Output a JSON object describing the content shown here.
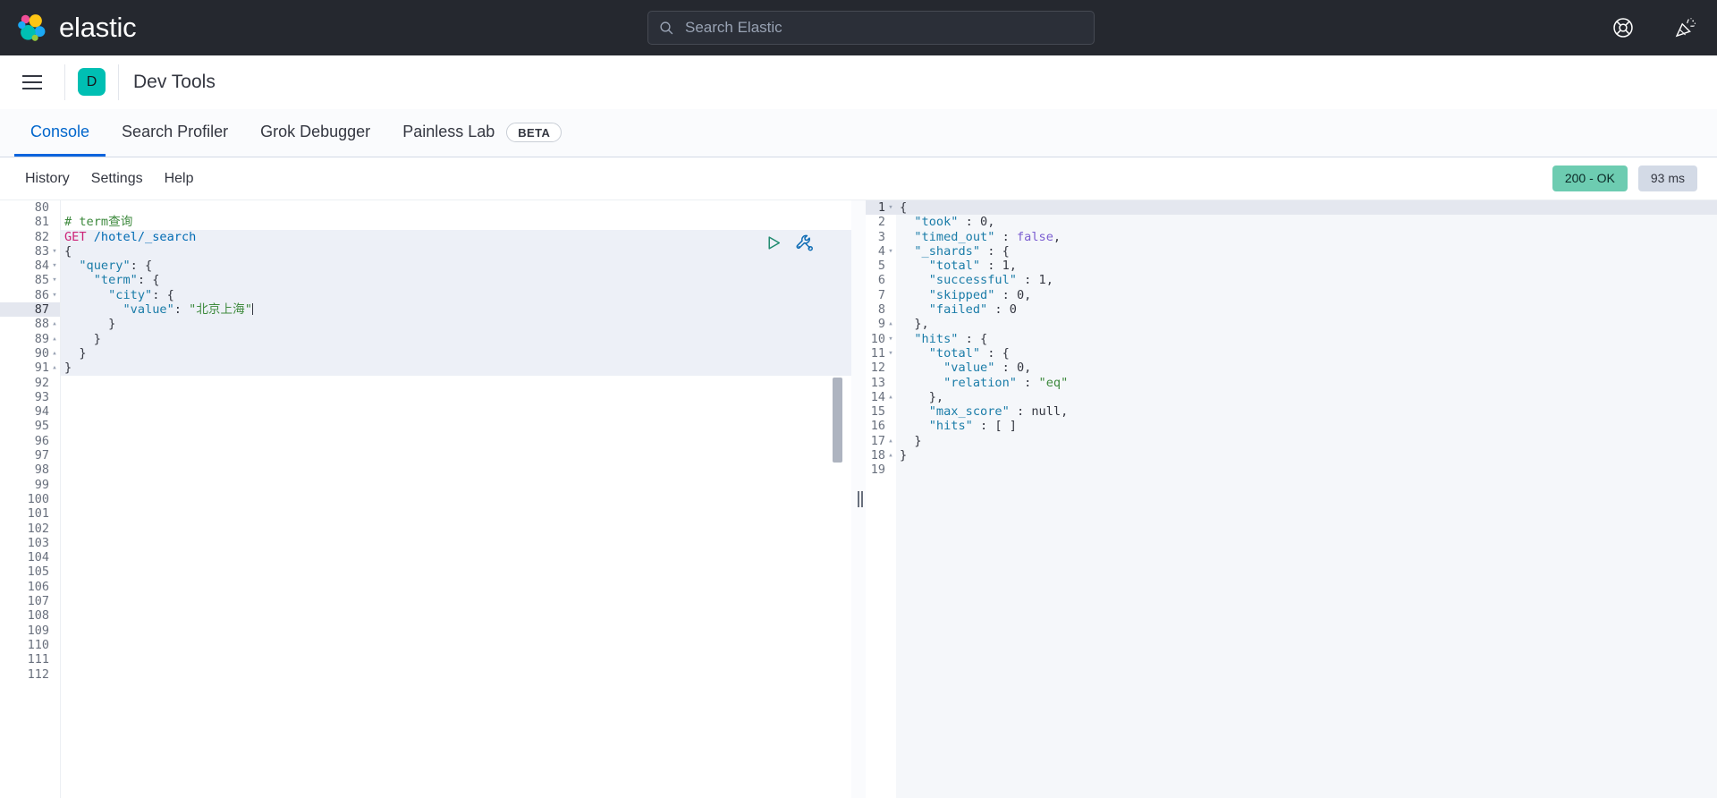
{
  "topbar": {
    "brand_name": "elastic",
    "logo_colors": {
      "pink": "#f04e98",
      "yellow": "#fec514",
      "blue": "#1ba9f5",
      "teal": "#00bfb3",
      "green": "#7de2d1",
      "lightgreen": "#93c83e"
    },
    "search": {
      "placeholder": "Search Elastic",
      "value": "",
      "icon": "search-icon"
    },
    "icons": [
      {
        "name": "help-lifebuoy-icon",
        "label": "Help"
      },
      {
        "name": "whats-new-party-popper-icon",
        "label": "What's new"
      }
    ]
  },
  "appheader": {
    "menu_icon": "hamburger-menu-icon",
    "app_badge_letter": "D",
    "app_badge_color": "#00bfb3",
    "title": "Dev Tools"
  },
  "tabs": [
    {
      "label": "Console",
      "active": true,
      "badge": null
    },
    {
      "label": "Search Profiler",
      "active": false,
      "badge": null
    },
    {
      "label": "Grok Debugger",
      "active": false,
      "badge": null
    },
    {
      "label": "Painless Lab",
      "active": false,
      "badge": "BETA"
    }
  ],
  "console_toolbar": {
    "buttons": [
      "History",
      "Settings",
      "Help"
    ],
    "status_code": "200 - OK",
    "status_color": "#6dccb1",
    "duration": "93 ms",
    "duration_color": "#d3dae6"
  },
  "request_editor": {
    "first_line_number": 80,
    "last_line_number": 112,
    "current_line": 87,
    "actions": [
      {
        "name": "send-request-play-icon",
        "color": "#1d8a6e"
      },
      {
        "name": "request-options-wrench-icon",
        "color": "#0d6bb4"
      }
    ],
    "lines": [
      {
        "n": 80,
        "fold": "",
        "segs": [],
        "in_block": false
      },
      {
        "n": 81,
        "fold": "",
        "segs": [
          {
            "t": "# term查询",
            "c": "tok-comment"
          }
        ],
        "in_block": false
      },
      {
        "n": 82,
        "fold": "",
        "segs": [
          {
            "t": "GET",
            "c": "tok-method"
          },
          {
            "t": " /hotel/_search",
            "c": "tok-url"
          }
        ],
        "in_block": true
      },
      {
        "n": 83,
        "fold": "▾",
        "segs": [
          {
            "t": "{",
            "c": "tok-punc"
          }
        ],
        "in_block": true
      },
      {
        "n": 84,
        "fold": "▾",
        "segs": [
          {
            "t": "  ",
            "c": "tok-punc"
          },
          {
            "t": "\"query\"",
            "c": "tok-key"
          },
          {
            "t": ": {",
            "c": "tok-punc"
          }
        ],
        "in_block": true
      },
      {
        "n": 85,
        "fold": "▾",
        "segs": [
          {
            "t": "    ",
            "c": "tok-punc"
          },
          {
            "t": "\"term\"",
            "c": "tok-key"
          },
          {
            "t": ": {",
            "c": "tok-punc"
          }
        ],
        "in_block": true
      },
      {
        "n": 86,
        "fold": "▾",
        "segs": [
          {
            "t": "      ",
            "c": "tok-punc"
          },
          {
            "t": "\"city\"",
            "c": "tok-key"
          },
          {
            "t": ": {",
            "c": "tok-punc"
          }
        ],
        "in_block": true
      },
      {
        "n": 87,
        "fold": "",
        "segs": [
          {
            "t": "        ",
            "c": "tok-punc"
          },
          {
            "t": "\"value\"",
            "c": "tok-key"
          },
          {
            "t": ": ",
            "c": "tok-punc"
          },
          {
            "t": "\"北京上海\"",
            "c": "tok-str"
          }
        ],
        "in_block": true,
        "caret": true
      },
      {
        "n": 88,
        "fold": "▴",
        "segs": [
          {
            "t": "      }",
            "c": "tok-punc"
          }
        ],
        "in_block": true
      },
      {
        "n": 89,
        "fold": "▴",
        "segs": [
          {
            "t": "    }",
            "c": "tok-punc"
          }
        ],
        "in_block": true
      },
      {
        "n": 90,
        "fold": "▴",
        "segs": [
          {
            "t": "  }",
            "c": "tok-punc"
          }
        ],
        "in_block": true
      },
      {
        "n": 91,
        "fold": "▴",
        "segs": [
          {
            "t": "}",
            "c": "tok-punc"
          }
        ],
        "in_block": true
      },
      {
        "n": 92,
        "fold": "",
        "segs": [],
        "in_block": false
      },
      {
        "n": 93,
        "fold": "",
        "segs": [],
        "in_block": false
      },
      {
        "n": 94,
        "fold": "",
        "segs": [],
        "in_block": false
      },
      {
        "n": 95,
        "fold": "",
        "segs": [],
        "in_block": false
      },
      {
        "n": 96,
        "fold": "",
        "segs": [],
        "in_block": false
      },
      {
        "n": 97,
        "fold": "",
        "segs": [],
        "in_block": false
      },
      {
        "n": 98,
        "fold": "",
        "segs": [],
        "in_block": false
      },
      {
        "n": 99,
        "fold": "",
        "segs": [],
        "in_block": false
      },
      {
        "n": 100,
        "fold": "",
        "segs": [],
        "in_block": false
      },
      {
        "n": 101,
        "fold": "",
        "segs": [],
        "in_block": false
      },
      {
        "n": 102,
        "fold": "",
        "segs": [],
        "in_block": false
      },
      {
        "n": 103,
        "fold": "",
        "segs": [],
        "in_block": false
      },
      {
        "n": 104,
        "fold": "",
        "segs": [],
        "in_block": false
      },
      {
        "n": 105,
        "fold": "",
        "segs": [],
        "in_block": false
      },
      {
        "n": 106,
        "fold": "",
        "segs": [],
        "in_block": false
      },
      {
        "n": 107,
        "fold": "",
        "segs": [],
        "in_block": false
      },
      {
        "n": 108,
        "fold": "",
        "segs": [],
        "in_block": false
      },
      {
        "n": 109,
        "fold": "",
        "segs": [],
        "in_block": false
      },
      {
        "n": 110,
        "fold": "",
        "segs": [],
        "in_block": false
      },
      {
        "n": 111,
        "fold": "",
        "segs": [],
        "in_block": false
      },
      {
        "n": 112,
        "fold": "",
        "segs": [],
        "in_block": false
      }
    ]
  },
  "response_editor": {
    "lines": [
      {
        "n": 1,
        "fold": "▾",
        "segs": [
          {
            "t": "{",
            "c": "tok-punc"
          }
        ],
        "cur": true
      },
      {
        "n": 2,
        "fold": "",
        "segs": [
          {
            "t": "  ",
            "c": "tok-punc"
          },
          {
            "t": "\"took\"",
            "c": "tok-key"
          },
          {
            "t": " : ",
            "c": "tok-punc"
          },
          {
            "t": "0",
            "c": "tok-num"
          },
          {
            "t": ",",
            "c": "tok-punc"
          }
        ]
      },
      {
        "n": 3,
        "fold": "",
        "segs": [
          {
            "t": "  ",
            "c": "tok-punc"
          },
          {
            "t": "\"timed_out\"",
            "c": "tok-key"
          },
          {
            "t": " : ",
            "c": "tok-punc"
          },
          {
            "t": "false",
            "c": "tok-bool"
          },
          {
            "t": ",",
            "c": "tok-punc"
          }
        ]
      },
      {
        "n": 4,
        "fold": "▾",
        "segs": [
          {
            "t": "  ",
            "c": "tok-punc"
          },
          {
            "t": "\"_shards\"",
            "c": "tok-key"
          },
          {
            "t": " : {",
            "c": "tok-punc"
          }
        ]
      },
      {
        "n": 5,
        "fold": "",
        "segs": [
          {
            "t": "    ",
            "c": "tok-punc"
          },
          {
            "t": "\"total\"",
            "c": "tok-key"
          },
          {
            "t": " : ",
            "c": "tok-punc"
          },
          {
            "t": "1",
            "c": "tok-num"
          },
          {
            "t": ",",
            "c": "tok-punc"
          }
        ]
      },
      {
        "n": 6,
        "fold": "",
        "segs": [
          {
            "t": "    ",
            "c": "tok-punc"
          },
          {
            "t": "\"successful\"",
            "c": "tok-key"
          },
          {
            "t": " : ",
            "c": "tok-punc"
          },
          {
            "t": "1",
            "c": "tok-num"
          },
          {
            "t": ",",
            "c": "tok-punc"
          }
        ]
      },
      {
        "n": 7,
        "fold": "",
        "segs": [
          {
            "t": "    ",
            "c": "tok-punc"
          },
          {
            "t": "\"skipped\"",
            "c": "tok-key"
          },
          {
            "t": " : ",
            "c": "tok-punc"
          },
          {
            "t": "0",
            "c": "tok-num"
          },
          {
            "t": ",",
            "c": "tok-punc"
          }
        ]
      },
      {
        "n": 8,
        "fold": "",
        "segs": [
          {
            "t": "    ",
            "c": "tok-punc"
          },
          {
            "t": "\"failed\"",
            "c": "tok-key"
          },
          {
            "t": " : ",
            "c": "tok-punc"
          },
          {
            "t": "0",
            "c": "tok-num"
          }
        ]
      },
      {
        "n": 9,
        "fold": "▴",
        "segs": [
          {
            "t": "  },",
            "c": "tok-punc"
          }
        ]
      },
      {
        "n": 10,
        "fold": "▾",
        "segs": [
          {
            "t": "  ",
            "c": "tok-punc"
          },
          {
            "t": "\"hits\"",
            "c": "tok-key"
          },
          {
            "t": " : {",
            "c": "tok-punc"
          }
        ]
      },
      {
        "n": 11,
        "fold": "▾",
        "segs": [
          {
            "t": "    ",
            "c": "tok-punc"
          },
          {
            "t": "\"total\"",
            "c": "tok-key"
          },
          {
            "t": " : {",
            "c": "tok-punc"
          }
        ]
      },
      {
        "n": 12,
        "fold": "",
        "segs": [
          {
            "t": "      ",
            "c": "tok-punc"
          },
          {
            "t": "\"value\"",
            "c": "tok-key"
          },
          {
            "t": " : ",
            "c": "tok-punc"
          },
          {
            "t": "0",
            "c": "tok-num"
          },
          {
            "t": ",",
            "c": "tok-punc"
          }
        ]
      },
      {
        "n": 13,
        "fold": "",
        "segs": [
          {
            "t": "      ",
            "c": "tok-punc"
          },
          {
            "t": "\"relation\"",
            "c": "tok-key"
          },
          {
            "t": " : ",
            "c": "tok-punc"
          },
          {
            "t": "\"eq\"",
            "c": "tok-str"
          }
        ]
      },
      {
        "n": 14,
        "fold": "▴",
        "segs": [
          {
            "t": "    },",
            "c": "tok-punc"
          }
        ]
      },
      {
        "n": 15,
        "fold": "",
        "segs": [
          {
            "t": "    ",
            "c": "tok-punc"
          },
          {
            "t": "\"max_score\"",
            "c": "tok-key"
          },
          {
            "t": " : ",
            "c": "tok-punc"
          },
          {
            "t": "null",
            "c": "tok-null"
          },
          {
            "t": ",",
            "c": "tok-punc"
          }
        ]
      },
      {
        "n": 16,
        "fold": "",
        "segs": [
          {
            "t": "    ",
            "c": "tok-punc"
          },
          {
            "t": "\"hits\"",
            "c": "tok-key"
          },
          {
            "t": " : [ ]",
            "c": "tok-punc"
          }
        ]
      },
      {
        "n": 17,
        "fold": "▴",
        "segs": [
          {
            "t": "  }",
            "c": "tok-punc"
          }
        ]
      },
      {
        "n": 18,
        "fold": "▴",
        "segs": [
          {
            "t": "}",
            "c": "tok-punc"
          }
        ]
      },
      {
        "n": 19,
        "fold": "",
        "segs": []
      }
    ]
  }
}
